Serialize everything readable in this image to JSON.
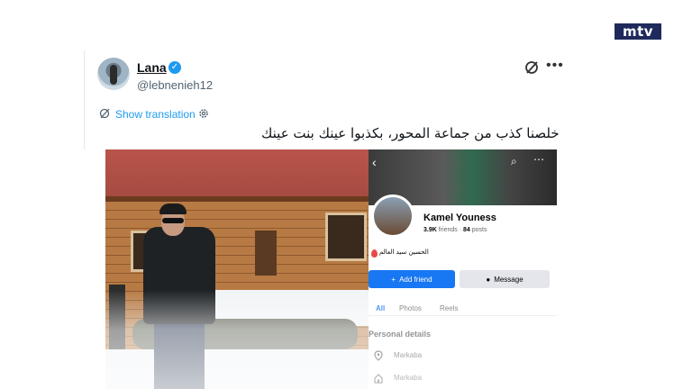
{
  "channel_logo": {
    "text": "mtv",
    "colors": {
      "background": "#1f2a5c",
      "accent": "#e21b23"
    }
  },
  "tweet": {
    "display_name": "Lana",
    "handle": "@lebnenieh12",
    "verified": true,
    "show_translation": "Show translation",
    "text": "خلصنا كذب من جماعة المحور، بكذبوا عينك بنت عينك",
    "icons": {
      "grok": "grok-icon",
      "more": "more-icon",
      "translate": "translate-icon",
      "settings": "gear-icon"
    }
  },
  "facebook_profile": {
    "name": "Kamel Youness",
    "friends": "3.9K",
    "friends_label": "friends",
    "separator": "·",
    "posts": "84",
    "posts_label": "posts",
    "bio": "الحسين سيد العالم",
    "add_friend": "Add friend",
    "message": "Message",
    "tabs": [
      "All",
      "Photos",
      "Reels"
    ],
    "active_tab": "All",
    "section_title": "Personal details",
    "details": [
      {
        "icon": "location-pin-icon",
        "text": "Markaba"
      },
      {
        "icon": "home-icon",
        "text": "Markaba"
      }
    ],
    "accent_color": "#1877f2"
  }
}
